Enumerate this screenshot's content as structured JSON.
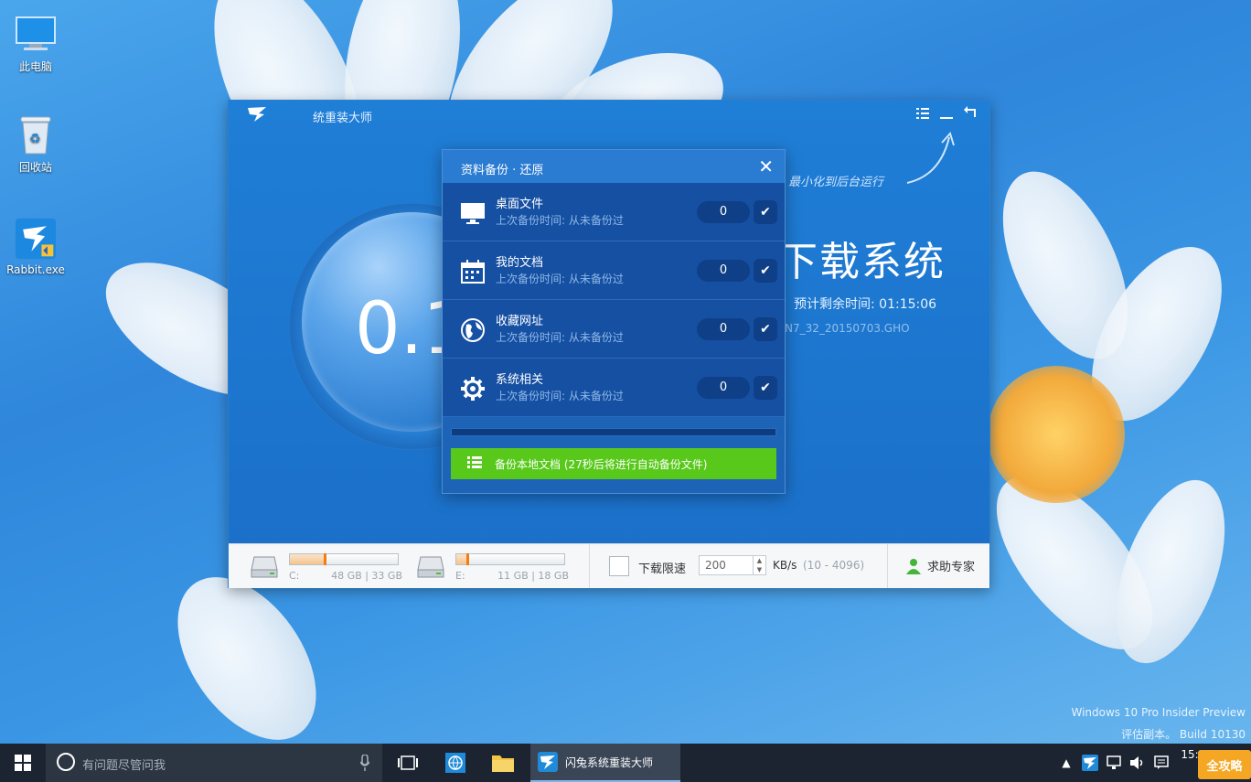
{
  "desktop": {
    "icons": [
      {
        "label": "此电脑"
      },
      {
        "label": "回收站"
      },
      {
        "label": "Rabbit.exe"
      }
    ],
    "watermark_line1": "Windows 10 Pro Insider Preview",
    "watermark_line2": "评估副本。 Build 10130"
  },
  "app": {
    "title": "统重装大师",
    "minimize_hint": "最小化到后台运行",
    "headline": "下载系统",
    "eta_label": "预计剩余时间: 01:15:06",
    "file_name": "N7_32_20150703.GHO",
    "progress_value": "0.1",
    "bottom": {
      "drives": [
        {
          "letter": "C:",
          "size": "48 GB | 33 GB"
        },
        {
          "letter": "E:",
          "size": "11 GB | 18 GB"
        }
      ],
      "limit_label": "下载限速",
      "limit_value": "200",
      "limit_unit": "KB/s",
      "limit_range": "(10 - 4096)",
      "help_label": "求助专家"
    }
  },
  "dialog": {
    "title": "资料备份 · 还原",
    "items": [
      {
        "name": "桌面文件",
        "sub": "上次备份时间: 从未备份过",
        "count": "0",
        "icon": "monitor-icon"
      },
      {
        "name": "我的文档",
        "sub": "上次备份时间: 从未备份过",
        "count": "0",
        "icon": "calendar-icon"
      },
      {
        "name": "收藏网址",
        "sub": "上次备份时间: 从未备份过",
        "count": "0",
        "icon": "globe-icon"
      },
      {
        "name": "系统相关",
        "sub": "上次备份时间: 从未备份过",
        "count": "0",
        "icon": "gear-icon"
      }
    ],
    "action_label": "备份本地文档 (27秒后将进行自动备份文件)"
  },
  "taskbar": {
    "search_placeholder": "有问题尽管问我",
    "active_app": "闪兔系统重装大师",
    "clock_time": "15:20",
    "corner_brand": "全攻略"
  },
  "colors": {
    "app_bg": "#1f7ed6",
    "dialog_bg": "#1d64b7",
    "action_green": "#58c91b",
    "taskbar": "#1b2430"
  }
}
